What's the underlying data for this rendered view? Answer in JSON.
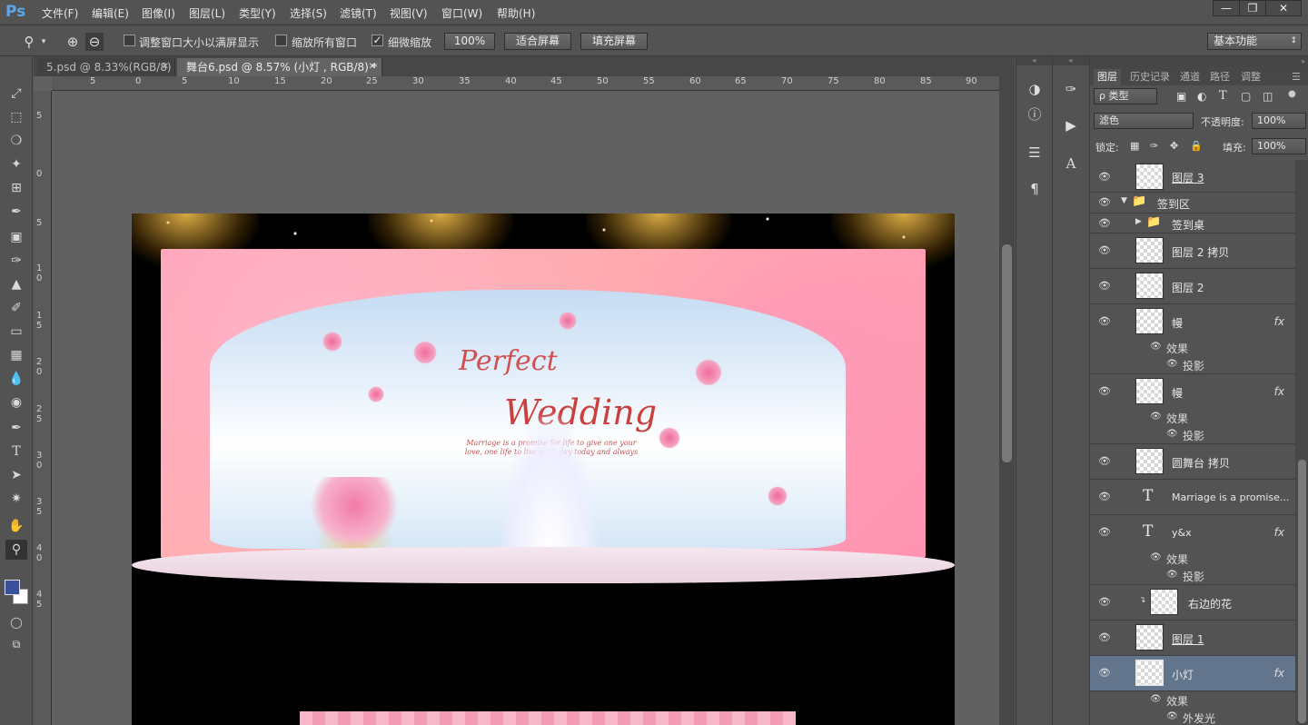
{
  "app": {
    "logo": "Ps"
  },
  "menu": [
    "文件(F)",
    "编辑(E)",
    "图像(I)",
    "图层(L)",
    "类型(Y)",
    "选择(S)",
    "滤镜(T)",
    "视图(V)",
    "窗口(W)",
    "帮助(H)"
  ],
  "window_controls": [
    "—",
    "❐",
    "✕"
  ],
  "options": {
    "resize_windows": "调整窗口大小以满屏显示",
    "zoom_all": "缩放所有窗口",
    "scrubby_zoom": "细微缩放",
    "scrubby_checked": true,
    "btn_100": "100%",
    "btn_fit": "适合屏幕",
    "btn_fill": "填充屏幕",
    "workspace": "基本功能"
  },
  "tabs": [
    {
      "label": "5.psd @ 8.33%(RGB/8)",
      "active": false
    },
    {
      "label": "舞台6.psd @ 8.57% (小灯 , RGB/8) *",
      "active": true
    }
  ],
  "ruler": {
    "top": [
      "5",
      "0",
      "5",
      "10",
      "15",
      "20",
      "25",
      "30",
      "35",
      "40",
      "45",
      "50",
      "55",
      "60",
      "65",
      "70",
      "75",
      "80",
      "85",
      "90"
    ],
    "left": [
      "5",
      "0",
      "5",
      "1\n0",
      "1\n5",
      "2\n0",
      "2\n5",
      "3\n0",
      "3\n5",
      "4\n0",
      "4\n5"
    ]
  },
  "artwork": {
    "title_line1": "Perfect",
    "title_line2": "Wedding",
    "verse": "Marriage is a promise for life to give one your love, one life to live each day today and always"
  },
  "panel": {
    "tabs": [
      "图层",
      "历史记录",
      "通道",
      "路径",
      "调整"
    ],
    "filter_kind": "ρ 类型",
    "blend_mode": "滤色",
    "opacity_label": "不透明度:",
    "opacity": "100%",
    "lock_label": "锁定:",
    "fill_label": "填充:",
    "fill": "100%"
  },
  "layers": [
    {
      "name": "图层 3",
      "kind": "pixel"
    },
    {
      "name": "签到区",
      "kind": "group-open"
    },
    {
      "name": "签到桌",
      "kind": "group-closed"
    },
    {
      "name": "图层 2 拷贝",
      "kind": "pixel"
    },
    {
      "name": "图层 2",
      "kind": "pixel"
    },
    {
      "name": "幔",
      "kind": "pixel",
      "fx": "fx",
      "effects_label": "效果",
      "effects": [
        "投影"
      ]
    },
    {
      "name": "幔",
      "kind": "pixel",
      "fx": "fx",
      "effects_label": "效果",
      "effects": [
        "投影"
      ]
    },
    {
      "name": "圆舞台 拷贝",
      "kind": "pixel"
    },
    {
      "name": "Marriage is a promise...",
      "kind": "text"
    },
    {
      "name": "y&x",
      "kind": "text",
      "fx": "fx",
      "effects_label": "效果",
      "effects": [
        "投影"
      ]
    },
    {
      "name": "右边的花",
      "kind": "clipped"
    },
    {
      "name": "图层 1",
      "kind": "pixel"
    },
    {
      "name": "小灯",
      "kind": "pixel",
      "fx": "fx",
      "selected": true,
      "effects_label": "效果",
      "effects": [
        "外发光"
      ]
    }
  ],
  "icons": {
    "eye": "eye-icon",
    "text_glyph": "T"
  }
}
